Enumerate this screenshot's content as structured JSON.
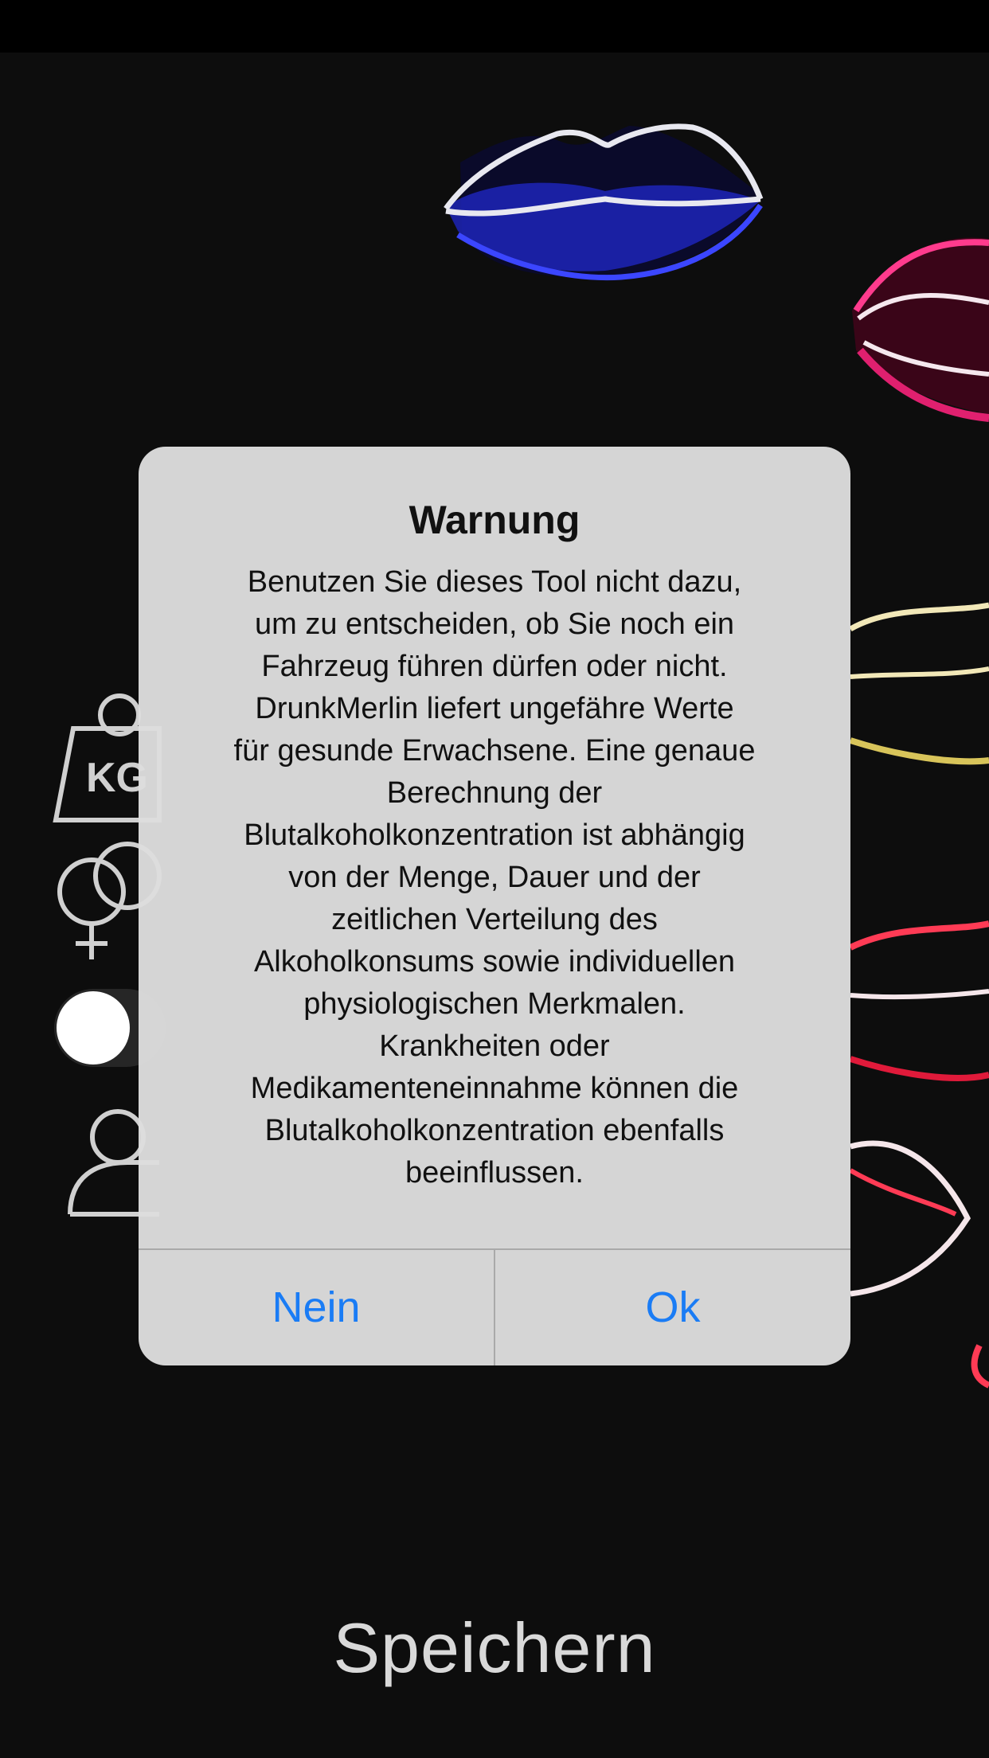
{
  "screen": {
    "save_label": "Speichern"
  },
  "alert": {
    "title": "Warnung",
    "message": "Benutzen Sie dieses Tool nicht dazu,\num zu entscheiden, ob Sie noch ein\nFahrzeug führen dürfen oder nicht.\nDrunkMerlin liefert ungefähre Werte\nfür gesunde Erwachsene. Eine genaue\nBerechnung der\nBlutalkoholkonzentration ist abhängig\nvon der Menge, Dauer und der\nzeitlichen Verteilung des\nAlkoholkonsums sowie individuellen\nphysiologischen Merkmalen.\nKrankheiten oder\nMedikamenteneinnahme können die\nBlutalkoholkonzentration ebenfalls\nbeeinflussen.",
    "buttons": {
      "no": "Nein",
      "ok": "Ok"
    }
  },
  "icons": {
    "weight": "weight-kg-icon",
    "weight_text": "KG",
    "gender": "gender-icon",
    "toggle": "toggle-switch",
    "person": "person-icon"
  },
  "colors": {
    "background": "#0d0d0d",
    "alert_bg": "#dedede",
    "button_blue": "#1a7cf5",
    "lips_blue": "#2b36e0",
    "lips_pink": "#e0206f",
    "lips_gold": "#d8c45a",
    "lips_red": "#e01a3a"
  }
}
